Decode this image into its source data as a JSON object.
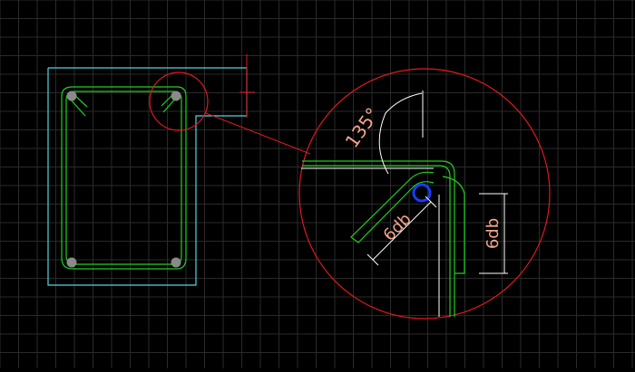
{
  "colors": {
    "background": "#000000",
    "grid": "#2a2a2a",
    "column_outline": "#4fd6e0",
    "stirrup": "#1fd11f",
    "detail_circle": "#e0191f",
    "dimension_text": "#f5a58a",
    "dimension_line": "#ffffff",
    "rebar": "#8a8a8a",
    "highlighted_bar": "#1a3cff"
  },
  "annotations": {
    "hook_angle": "135°",
    "hook_extension": "6db",
    "bend_extension": "6db"
  },
  "icons": {
    "corner_bar": "rebar-dot-icon",
    "detail_bar": "highlighted-rebar-circle-icon"
  }
}
